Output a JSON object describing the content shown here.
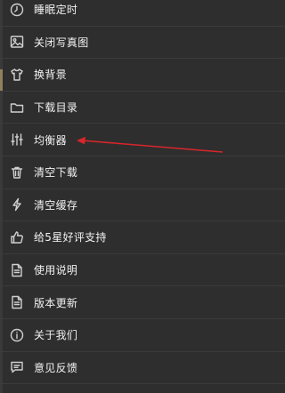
{
  "menu": {
    "items": [
      {
        "label": "睡眠定时",
        "icon": "timer-icon"
      },
      {
        "label": "关闭写真图",
        "icon": "image-icon"
      },
      {
        "label": "换背景",
        "icon": "tshirt-icon"
      },
      {
        "label": "下载目录",
        "icon": "folder-icon"
      },
      {
        "label": "均衡器",
        "icon": "equalizer-icon"
      },
      {
        "label": "清空下载",
        "icon": "trash-icon"
      },
      {
        "label": "清空缓存",
        "icon": "lightning-icon"
      },
      {
        "label": "给5星好评支持",
        "icon": "thumbs-up-icon"
      },
      {
        "label": "使用说明",
        "icon": "document-icon"
      },
      {
        "label": "版本更新",
        "icon": "document-icon"
      },
      {
        "label": "关于我们",
        "icon": "info-icon"
      },
      {
        "label": "意见反馈",
        "icon": "chat-icon"
      }
    ]
  },
  "annotation": {
    "color": "#d8262a"
  }
}
